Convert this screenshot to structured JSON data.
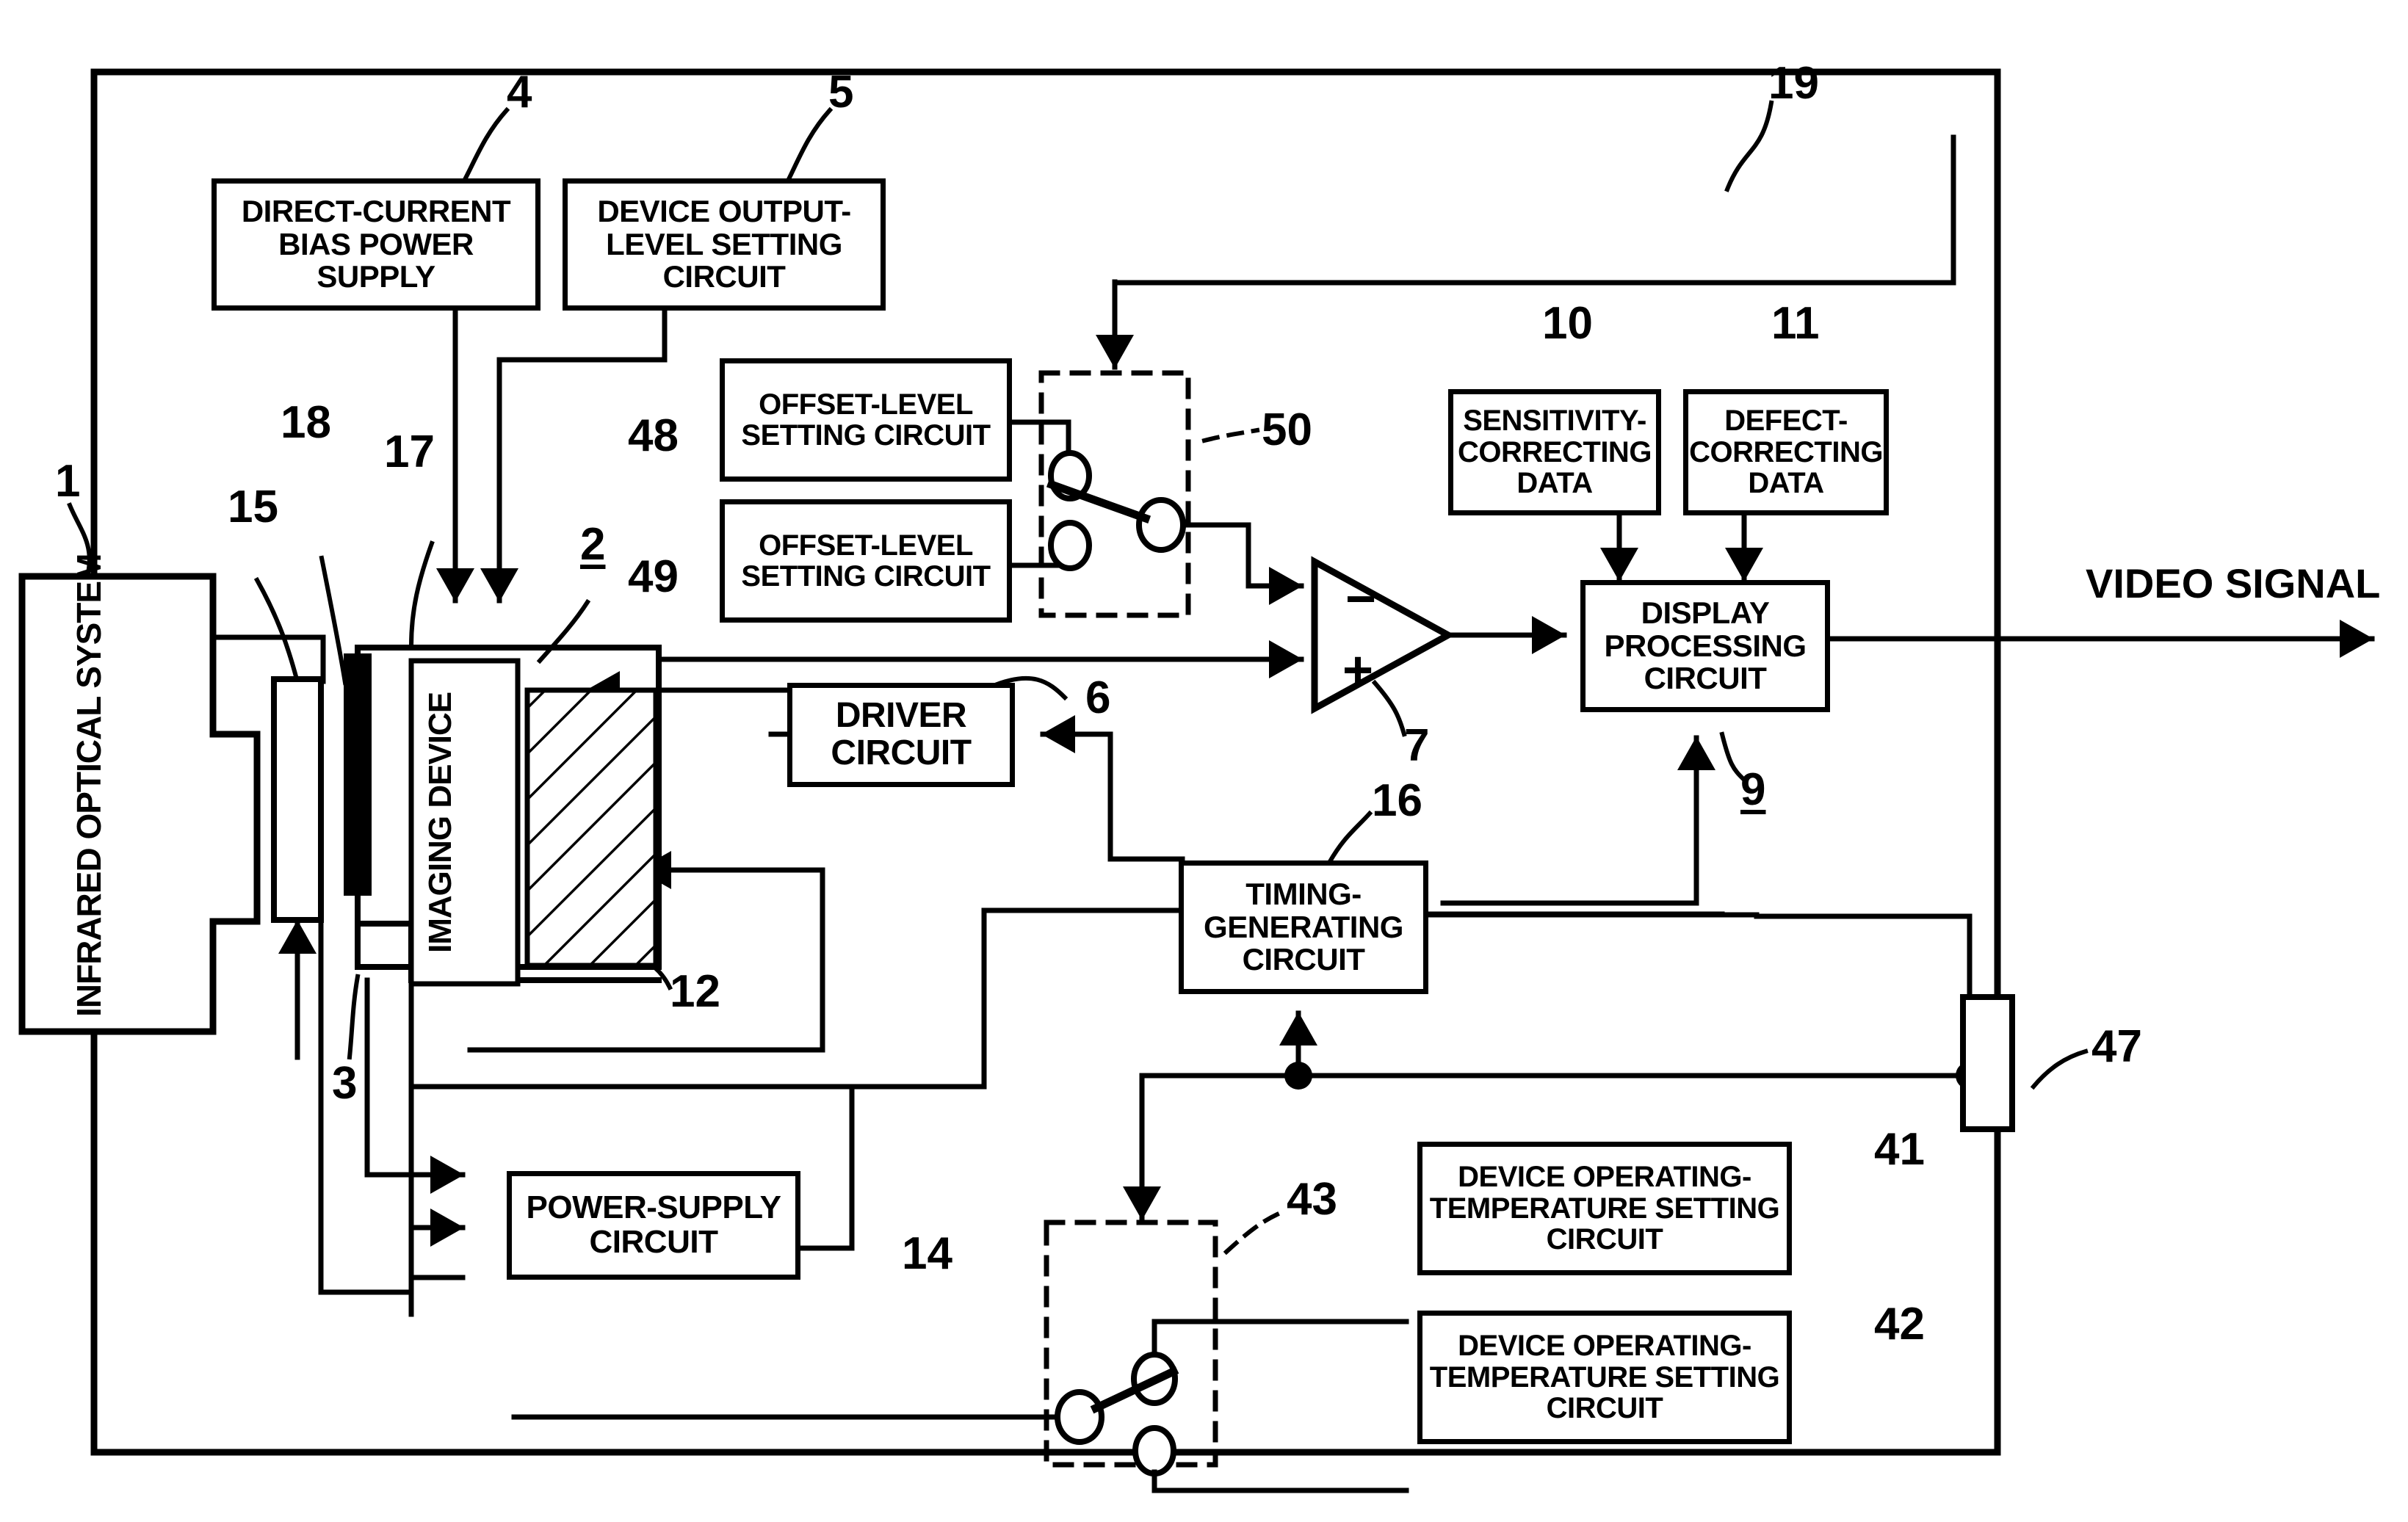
{
  "figure": {
    "type": "patent-block-diagram",
    "subject": "Infrared imaging apparatus block diagram"
  },
  "blocks": {
    "dc_bias": "DIRECT-CURRENT BIAS POWER SUPPLY",
    "dev_out_level": "DEVICE OUTPUT-LEVEL SETTING CIRCUIT",
    "offset48": "OFFSET-LEVEL SETTING CIRCUIT",
    "offset49": "OFFSET-LEVEL SETTING CIRCUIT",
    "sensitivity": "SENSITIVITY-CORRECTING DATA",
    "defect": "DEFECT-CORRECTING DATA",
    "display_proc": "DISPLAY PROCESSING CIRCUIT",
    "driver": "DRIVER CIRCUIT",
    "timing": "TIMING-GENERATING CIRCUIT",
    "power_supply": "POWER-SUPPLY CIRCUIT",
    "devtemp41": "DEVICE OPERATING-TEMPERATURE SETTING CIRCUIT",
    "devtemp42": "DEVICE OPERATING-TEMPERATURE SETTING CIRCUIT",
    "infrared_optical": "INFRARED OPTICAL SYSTEM",
    "imaging_device": "IMAGING DEVICE"
  },
  "labels": {
    "video_signal": "VIDEO SIGNAL",
    "amp_minus": "−",
    "amp_plus": "+"
  },
  "refs": {
    "r1": "1",
    "r2": "2",
    "r3": "3",
    "r4": "4",
    "r5": "5",
    "r6": "6",
    "r7": "7",
    "r9": "9",
    "r10": "10",
    "r11": "11",
    "r12": "12",
    "r14": "14",
    "r15": "15",
    "r16": "16",
    "r17": "17",
    "r18": "18",
    "r19": "19",
    "r41": "41",
    "r42": "42",
    "r43": "43",
    "r47": "47",
    "r48": "48",
    "r49": "49",
    "r50": "50"
  },
  "colors": {
    "ink": "#000000",
    "paper": "#ffffff"
  }
}
